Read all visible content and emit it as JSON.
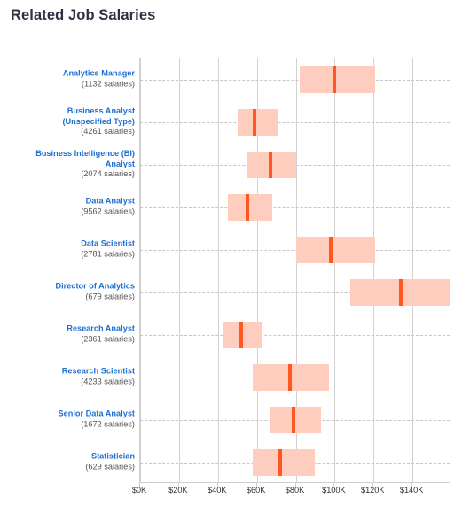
{
  "chart_title": "Related Job Salaries",
  "chart_data": {
    "type": "bar",
    "subtype": "range-band-with-median",
    "title": "Related Job Salaries",
    "xlabel": "",
    "ylabel": "",
    "xlim": [
      0,
      160000
    ],
    "xtick_labels": [
      "$0K",
      "$20K",
      "$40K",
      "$60K",
      "$80K",
      "$100K",
      "$120K",
      "$140K"
    ],
    "xtick_values": [
      0,
      20000,
      40000,
      60000,
      80000,
      100000,
      120000,
      140000
    ],
    "grid": "vertical-solid-horizontal-dashed",
    "legend": "none",
    "band_color": "#ffcdbd",
    "median_color": "#ff5722",
    "label_color": "#1f6fd0",
    "count_color": "#555555",
    "categories": [
      "Analytics Manager",
      "Business Analyst (Unspecified Type)",
      "Business Intelligence (BI) Analyst",
      "Data Analyst",
      "Data Scientist",
      "Director of Analytics",
      "Research Analyst",
      "Research Scientist",
      "Senior Data Analyst",
      "Statistician"
    ],
    "rows": [
      {
        "job": "Analytics Manager",
        "job_line2": "",
        "count_label": "(1132 salaries)",
        "count": 1132,
        "low": 82000,
        "high": 121000,
        "median": 100000
      },
      {
        "job": "Business Analyst",
        "job_line2": "(Unspecified Type)",
        "count_label": "(4261 salaries)",
        "count": 4261,
        "low": 50000,
        "high": 71000,
        "median": 59000
      },
      {
        "job": "Business Intelligence (BI)",
        "job_line2": "Analyst",
        "count_label": "(2074 salaries)",
        "count": 2074,
        "low": 55000,
        "high": 80000,
        "median": 67000
      },
      {
        "job": "Data Analyst",
        "job_line2": "",
        "count_label": "(9562 salaries)",
        "count": 9562,
        "low": 45000,
        "high": 68000,
        "median": 55000
      },
      {
        "job": "Data Scientist",
        "job_line2": "",
        "count_label": "(2781 salaries)",
        "count": 2781,
        "low": 80000,
        "high": 121000,
        "median": 98000
      },
      {
        "job": "Director of Analytics",
        "job_line2": "",
        "count_label": "(679 salaries)",
        "count": 679,
        "low": 108000,
        "high": 159000,
        "median": 134000
      },
      {
        "job": "Research Analyst",
        "job_line2": "",
        "count_label": "(2361 salaries)",
        "count": 2361,
        "low": 43000,
        "high": 63000,
        "median": 52000
      },
      {
        "job": "Research Scientist",
        "job_line2": "",
        "count_label": "(4233 salaries)",
        "count": 4233,
        "low": 58000,
        "high": 97000,
        "median": 77000
      },
      {
        "job": "Senior Data Analyst",
        "job_line2": "",
        "count_label": "(1672 salaries)",
        "count": 1672,
        "low": 67000,
        "high": 93000,
        "median": 79000
      },
      {
        "job": "Statistician",
        "job_line2": "",
        "count_label": "(629 salaries)",
        "count": 629,
        "low": 58000,
        "high": 90000,
        "median": 72000
      }
    ]
  }
}
